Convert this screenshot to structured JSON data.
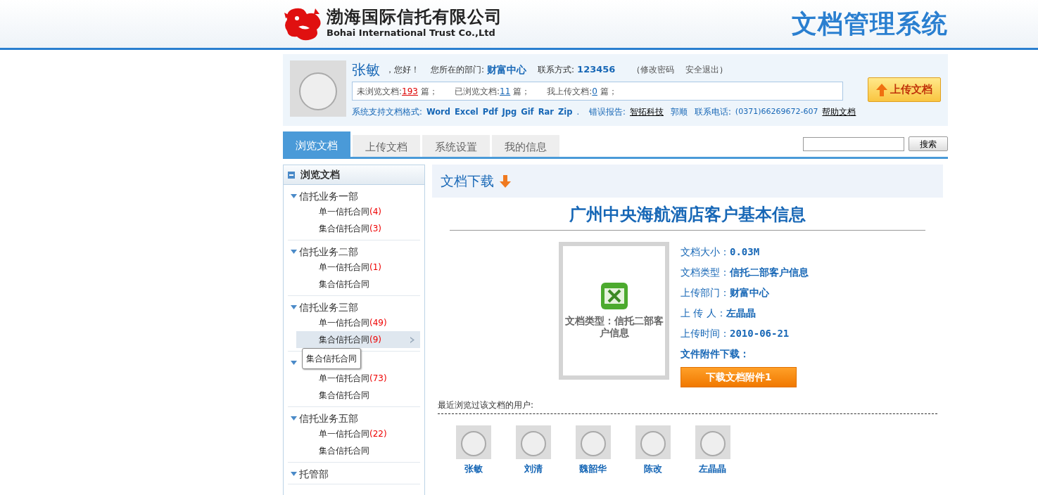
{
  "header": {
    "company_cn": "渤海国际信托有限公司",
    "company_en": "Bohai International Trust Co.,Ltd",
    "system_title": "文档管理系统"
  },
  "user": {
    "name": "张敏",
    "greeting": "，您好！",
    "dept_label": "您所在的部门:",
    "dept": "财富中心",
    "contact_label": "联系方式:",
    "contact": "123456",
    "links_open": "（",
    "links": [
      "修改密码",
      "安全退出"
    ],
    "links_close": "）",
    "stats": [
      {
        "label": "未浏览文档:",
        "count": "193",
        "unit": "篇；",
        "highlight": true
      },
      {
        "label": "已浏览文档:",
        "count": "11",
        "unit": "篇；",
        "highlight": false
      },
      {
        "label": "我上传文档:",
        "count": "0",
        "unit": "篇；",
        "highlight": false
      }
    ],
    "formats_label": "系统支持文档格式:",
    "formats": [
      "Word",
      "Excel",
      "Pdf",
      "Jpg",
      "Gif",
      "Rar",
      "Zip"
    ],
    "formats_end": ".",
    "error_label": "错误报告:",
    "error_link": "智拓科技",
    "person": "郭顺",
    "phone_label": "联系电话:",
    "phone": "(0371)66269672-607",
    "help_link": "帮助文档"
  },
  "upload_button": "上传文档",
  "tabs": [
    {
      "label": "浏览文档",
      "selected": true
    },
    {
      "label": "上传文档",
      "selected": false
    },
    {
      "label": "系统设置",
      "selected": false
    },
    {
      "label": "我的信息",
      "selected": false
    }
  ],
  "search": {
    "button": "搜索"
  },
  "sidebar": {
    "title": "浏览文档",
    "groups": [
      {
        "label": "信托业务一部",
        "expanded": true,
        "children": [
          {
            "label": "单一信托合同",
            "count": "(4)",
            "selected": false
          },
          {
            "label": "集合信托合同",
            "count": "(3)",
            "selected": false
          }
        ]
      },
      {
        "label": "信托业务二部",
        "expanded": true,
        "children": [
          {
            "label": "单一信托合同",
            "count": "(1)",
            "selected": false
          },
          {
            "label": "集合信托合同",
            "selected": false
          }
        ]
      },
      {
        "label": "信托业务三部",
        "expanded": true,
        "children": [
          {
            "label": "单一信托合同",
            "count": "(49)",
            "selected": false
          },
          {
            "label": "集合信托合同",
            "count": "(9)",
            "selected": true,
            "tooltip": "集合信托合同"
          }
        ]
      },
      {
        "expanded": true,
        "children": [
          {
            "label": "单一信托合同",
            "count": "(73)",
            "selected": false
          },
          {
            "label": "集合信托合同",
            "selected": false
          }
        ]
      },
      {
        "label": "信托业务五部",
        "expanded": true,
        "children": [
          {
            "label": "单一信托合同",
            "count": "(22)",
            "selected": false
          },
          {
            "label": "集合信托合同",
            "selected": false
          }
        ]
      },
      {
        "label": "托管部",
        "expanded": true
      }
    ]
  },
  "document": {
    "section_title": "文档下载",
    "title": "广州中央海航酒店客户基本信息",
    "thumbnail_caption": "文档类型：信托二部客户信息",
    "fields": [
      {
        "label": "文档大小：",
        "value": "0.03M"
      },
      {
        "label": "文档类型：",
        "value": "信托二部客户信息"
      },
      {
        "label": "上传部门：",
        "value": "财富中心"
      },
      {
        "label": "上 传 人：",
        "value": "左晶晶"
      },
      {
        "label": "上传时间：",
        "value": "2010-06-21"
      }
    ],
    "attachment_label": "文件附件下载：",
    "download_button": "下载文档附件1"
  },
  "recent": {
    "label": "最近浏览过该文档的用户:",
    "users": [
      "张敏",
      "刘清",
      "魏韶华",
      "陈改",
      "左晶晶"
    ]
  }
}
